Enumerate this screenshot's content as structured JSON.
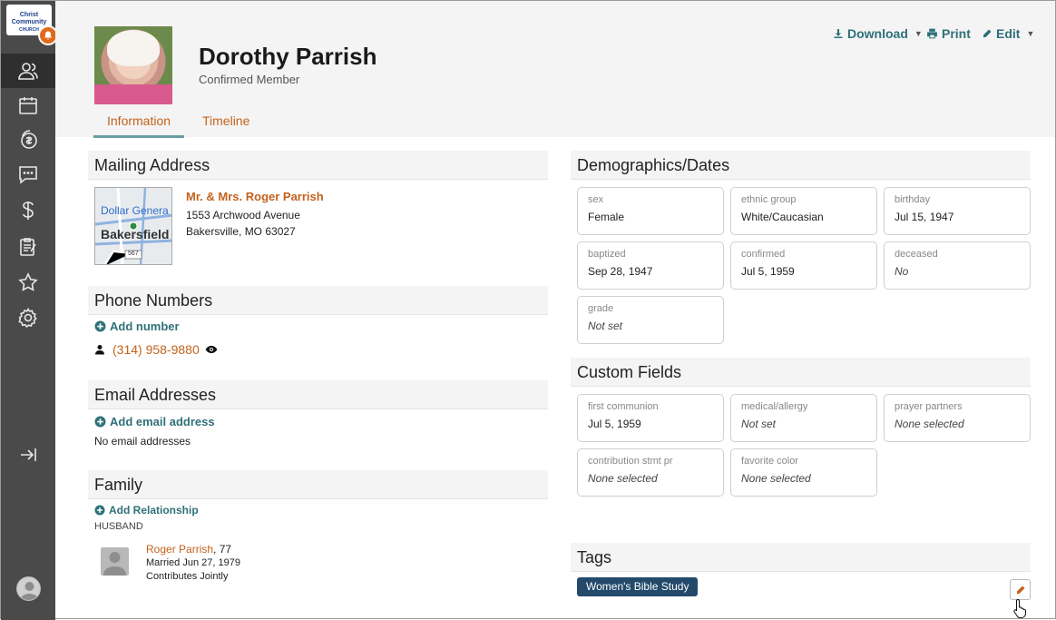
{
  "logo": {
    "line1": "Christ",
    "line2": "Community",
    "line3": "CHURCH"
  },
  "sidebar": {
    "items": [
      {
        "icon": "people-icon",
        "active": true
      },
      {
        "icon": "calendar-icon"
      },
      {
        "icon": "giving-icon"
      },
      {
        "icon": "chat-icon"
      },
      {
        "icon": "dollar-icon"
      },
      {
        "icon": "forms-icon"
      },
      {
        "icon": "star-icon"
      },
      {
        "icon": "gear-icon"
      },
      {
        "icon": "collapse-icon"
      }
    ]
  },
  "header": {
    "name": "Dorothy Parrish",
    "status": "Confirmed Member",
    "tabs": [
      {
        "label": "Information"
      },
      {
        "label": "Timeline"
      }
    ],
    "actions": {
      "download": "Download",
      "print": "Print",
      "edit": "Edit"
    }
  },
  "mailing": {
    "title": "Mailing Address",
    "addressee": "Mr. & Mrs. Roger Parrish",
    "line1": "1553 Archwood Avenue",
    "line2": "Bakersville, MO 63027",
    "map": {
      "place1": "Dollar Genera",
      "place2": "Bakersfield",
      "road": "567"
    }
  },
  "phones": {
    "title": "Phone Numbers",
    "add": "Add number",
    "number": "(314) 958-9880"
  },
  "emails": {
    "title": "Email Addresses",
    "add": "Add email address",
    "empty": "No email addresses"
  },
  "family": {
    "title": "Family",
    "add": "Add Relationship",
    "relation": "HUSBAND",
    "member_name": "Roger Parrish",
    "member_age": ", 77",
    "married": "Married Jun 27, 1979",
    "contrib": "Contributes Jointly"
  },
  "demographics": {
    "title": "Demographics/Dates",
    "fields": [
      {
        "label": "sex",
        "value": "Female"
      },
      {
        "label": "ethnic group",
        "value": "White/Caucasian"
      },
      {
        "label": "birthday",
        "value": "Jul 15, 1947"
      },
      {
        "label": "baptized",
        "value": "Sep 28, 1947"
      },
      {
        "label": "confirmed",
        "value": "Jul 5, 1959"
      },
      {
        "label": "deceased",
        "value": "No"
      },
      {
        "label": "grade",
        "value": "Not set"
      }
    ]
  },
  "custom": {
    "title": "Custom Fields",
    "fields": [
      {
        "label": "first communion",
        "value": "Jul 5, 1959"
      },
      {
        "label": "medical/allergy",
        "value": "Not set"
      },
      {
        "label": "prayer partners",
        "value": "None selected"
      },
      {
        "label": "contribution stmt pr",
        "value": "None selected"
      },
      {
        "label": "favorite color",
        "value": "None selected"
      }
    ]
  },
  "tags": {
    "title": "Tags",
    "items": [
      "Women's Bible Study"
    ]
  },
  "colors": {
    "accent": "#c4621c",
    "teal": "#2f7178",
    "tag": "#234a6b",
    "sidebar": "#4a4a4a"
  }
}
